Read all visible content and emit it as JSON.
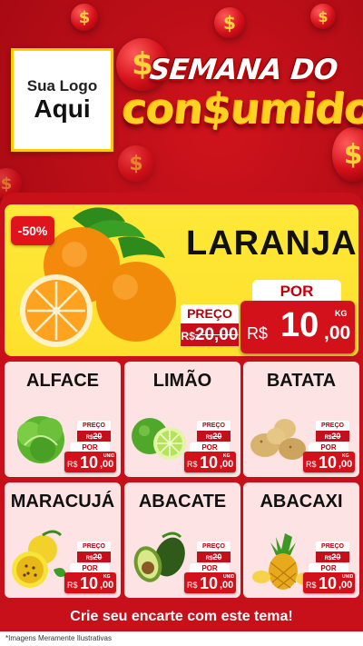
{
  "header": {
    "logo_line1": "Sua Logo",
    "logo_line2": "Aqui",
    "title_line1": "SEMANA DO",
    "title_line2": "con$umidor",
    "coin_symbol": "$"
  },
  "featured": {
    "discount_badge": "-50%",
    "name": "LARANJA",
    "old_price_label": "PREÇO",
    "old_price_currency": "R$",
    "old_price_value": "20,00",
    "new_price_label": "POR",
    "new_price_currency": "R$",
    "new_price_int": "10",
    "new_price_dec": ",00",
    "unit": "KG"
  },
  "products": [
    {
      "name": "ALFACE",
      "old_label": "PREÇO",
      "old_cur": "R$",
      "old_val": "20",
      "new_label": "POR",
      "cur": "R$",
      "int": "10",
      "dec": ",00",
      "unit": "UNID"
    },
    {
      "name": "LIMÃO",
      "old_label": "PREÇO",
      "old_cur": "R$",
      "old_val": "20",
      "new_label": "POR",
      "cur": "R$",
      "int": "10",
      "dec": ",00",
      "unit": "KG"
    },
    {
      "name": "BATATA",
      "old_label": "PREÇO",
      "old_cur": "R$",
      "old_val": "20",
      "new_label": "POR",
      "cur": "R$",
      "int": "10",
      "dec": ",00",
      "unit": "KG"
    },
    {
      "name": "MARACUJÁ",
      "old_label": "PREÇO",
      "old_cur": "R$",
      "old_val": "20",
      "new_label": "POR",
      "cur": "R$",
      "int": "10",
      "dec": ",00",
      "unit": "KG"
    },
    {
      "name": "ABACATE",
      "old_label": "PREÇO",
      "old_cur": "R$",
      "old_val": "20",
      "new_label": "POR",
      "cur": "R$",
      "int": "10",
      "dec": ",00",
      "unit": "UNID"
    },
    {
      "name": "ABACAXI",
      "old_label": "PREÇO",
      "old_cur": "R$",
      "old_val": "20",
      "new_label": "POR",
      "cur": "R$",
      "int": "10",
      "dec": ",00",
      "unit": "UNID"
    }
  ],
  "cta": "Crie seu encarte com este tema!",
  "footnote": "*Imagens Meramente Ilustrativas",
  "colors": {
    "background": "#b00c16",
    "panel_yellow": "#fde02c",
    "card_bg": "#fde3e3",
    "price_red": "#d3111b",
    "title_yellow": "#ffd21f"
  }
}
